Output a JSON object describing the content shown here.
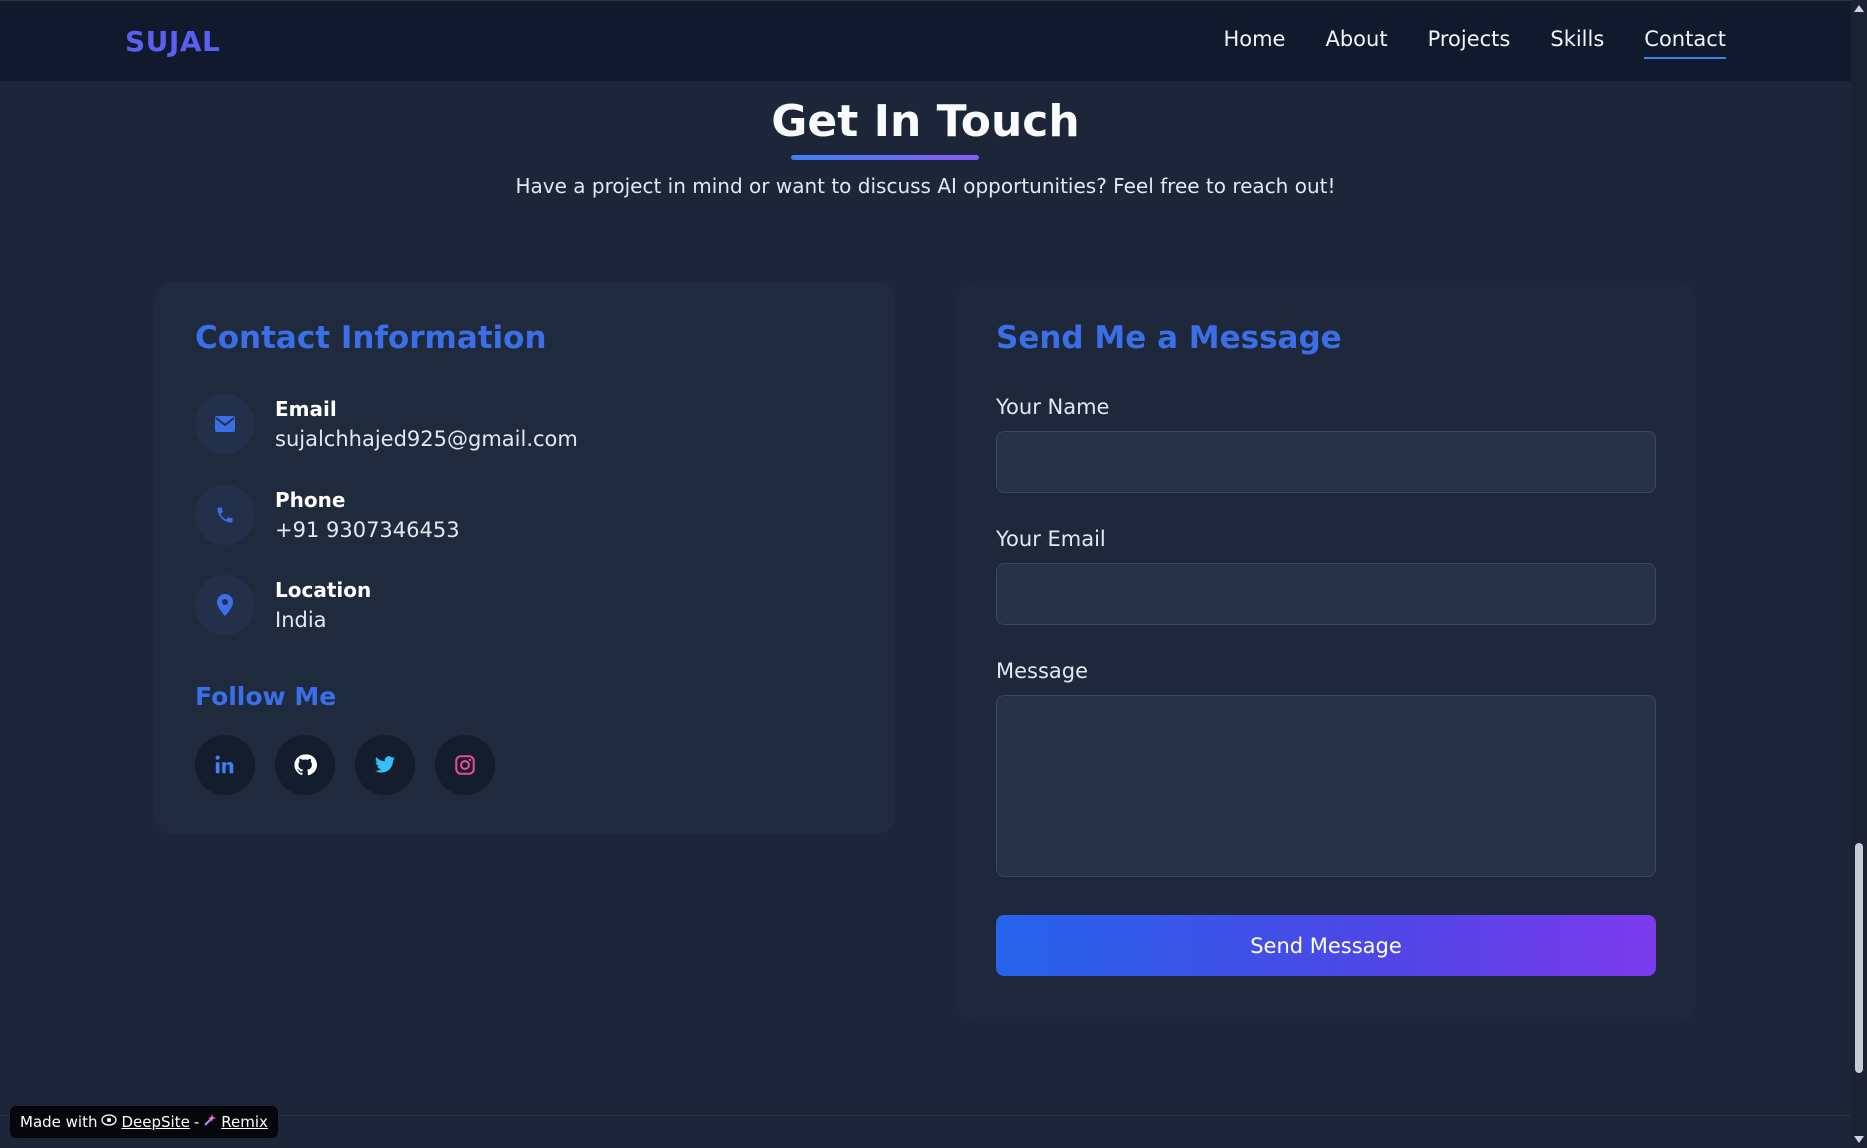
{
  "nav": {
    "brand": "SUJAL",
    "links": [
      "Home",
      "About",
      "Projects",
      "Skills",
      "Contact"
    ],
    "active": "Contact"
  },
  "section": {
    "title": "Get In Touch",
    "subtitle": "Have a project in mind or want to discuss AI opportunities? Feel free to reach out!"
  },
  "contact_info": {
    "title": "Contact Information",
    "items": [
      {
        "icon": "envelope-icon",
        "label": "Email",
        "value": "sujalchhajed925@gmail.com"
      },
      {
        "icon": "phone-icon",
        "label": "Phone",
        "value": "+91 9307346453"
      },
      {
        "icon": "location-pin-icon",
        "label": "Location",
        "value": "India"
      }
    ],
    "follow_title": "Follow Me",
    "socials": [
      "linkedin-icon",
      "github-icon",
      "twitter-icon",
      "instagram-icon"
    ]
  },
  "form": {
    "title": "Send Me a Message",
    "name_label": "Your Name",
    "email_label": "Your Email",
    "message_label": "Message",
    "name_value": "",
    "email_value": "",
    "message_value": "",
    "submit_label": "Send Message"
  },
  "badge": {
    "prefix": "Made with",
    "link1": "DeepSite",
    "separator": "-",
    "link2": "Remix"
  },
  "colors": {
    "accent": "#3b6fe8",
    "background": "#1c2638",
    "navbar": "#111a2c",
    "button_gradient_start": "#2563eb",
    "button_gradient_end": "#7c3aed"
  }
}
